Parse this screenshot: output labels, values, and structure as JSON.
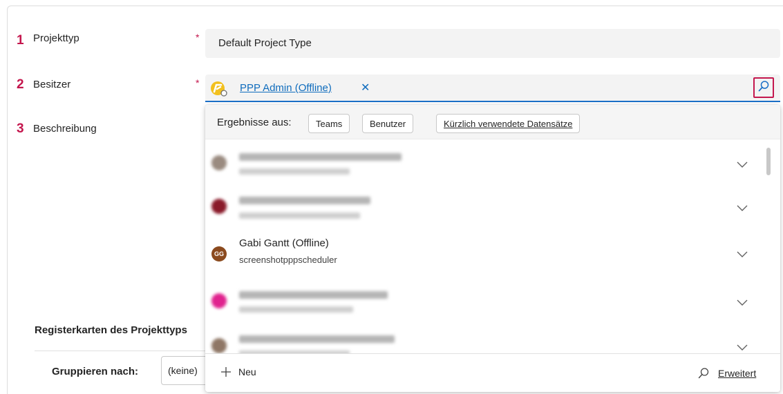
{
  "form": {
    "fields": [
      {
        "number": "1",
        "label": "Projekttyp",
        "required": "*",
        "value": "Default Project Type"
      },
      {
        "number": "2",
        "label": "Besitzer",
        "required": "*"
      },
      {
        "number": "3",
        "label": "Beschreibung"
      }
    ],
    "owner": {
      "name": "PPP Admin (Offline)",
      "remove_glyph": "✕",
      "icon": "user-offline-icon",
      "search_icon": "search-icon"
    }
  },
  "lookup_dropdown": {
    "filter_label": "Ergebnisse aus:",
    "filters": [
      "Teams",
      "Benutzer",
      "Kürzlich verwendete Datensätze"
    ],
    "results": [
      {
        "blurred": true,
        "avatar_color": "#9a8b80"
      },
      {
        "blurred": true,
        "avatar_color": "#8a1a2a"
      },
      {
        "blurred": false,
        "initials": "GG",
        "name": "Gabi Gantt (Offline)",
        "subtitle": "screenshotpppscheduler",
        "avatar_color": "#8b4a1e"
      },
      {
        "blurred": true,
        "avatar_color": "#e0228e"
      },
      {
        "blurred": true,
        "avatar_color": "#8f7766"
      }
    ],
    "new_label": "Neu",
    "advanced_label": "Erweitert"
  },
  "tabs_section": {
    "title": "Registerkarten des Projekttyps",
    "group_by_label": "Gruppieren nach:",
    "group_by_value": "(keine)"
  },
  "colors": {
    "accent_red": "#c4164d",
    "link_blue": "#0f6cbd"
  }
}
